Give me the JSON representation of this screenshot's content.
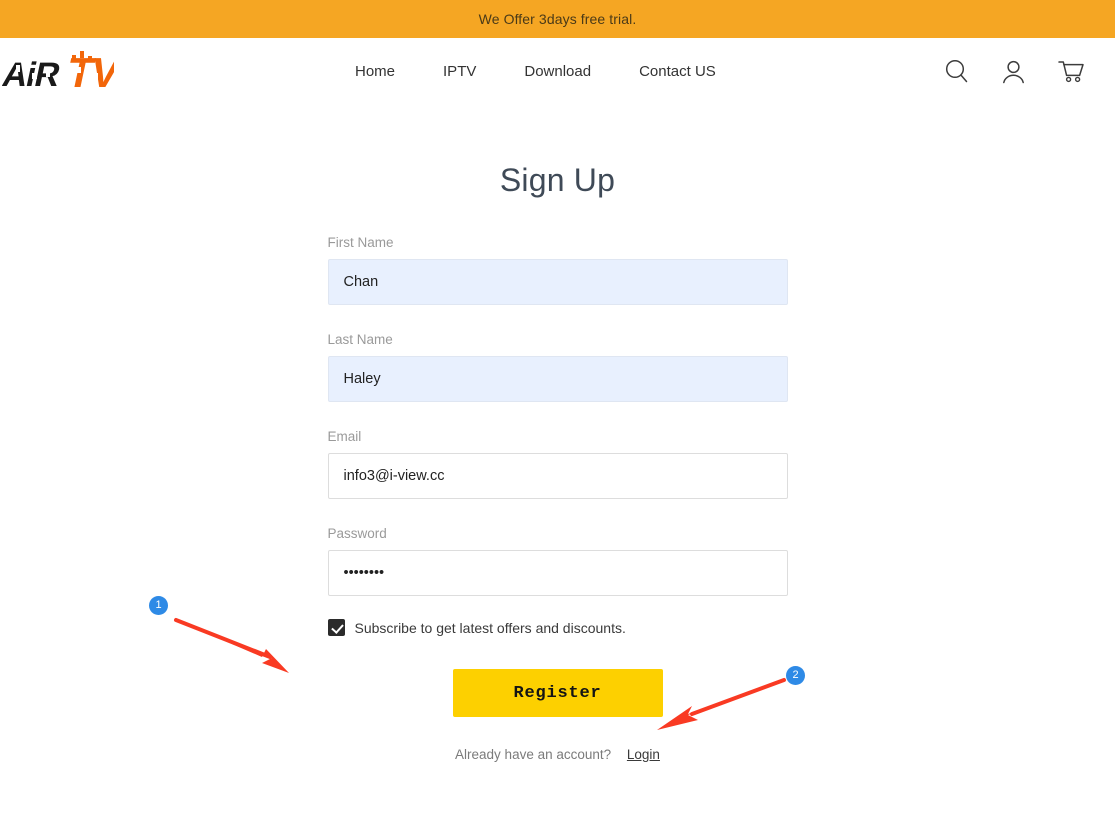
{
  "promo": {
    "text": "We Offer 3days free trial."
  },
  "header": {
    "logo": {
      "name": "airtv-logo",
      "text_dark": "AiR",
      "text_accent": "TV",
      "color_dark": "#1a1a1a",
      "color_accent": "#f2660a"
    },
    "nav": [
      {
        "label": "Home",
        "name": "nav-home"
      },
      {
        "label": "IPTV",
        "name": "nav-iptv"
      },
      {
        "label": "Download",
        "name": "nav-download"
      },
      {
        "label": "Contact US",
        "name": "nav-contact-us"
      }
    ],
    "icons": [
      {
        "name": "search-icon",
        "label": "Search"
      },
      {
        "name": "user-icon",
        "label": "Account"
      },
      {
        "name": "cart-icon",
        "label": "Cart"
      }
    ]
  },
  "main": {
    "title": "Sign Up",
    "fields": [
      {
        "label": "First Name",
        "value": "Chan",
        "placeholder": "First Name",
        "type": "text",
        "autofilled": true,
        "name": "first-name"
      },
      {
        "label": "Last Name",
        "value": "Haley",
        "placeholder": "Last Name",
        "type": "text",
        "autofilled": true,
        "name": "last-name"
      },
      {
        "label": "Email",
        "value": "info3@i-view.cc",
        "placeholder": "Email",
        "type": "text",
        "autofilled": false,
        "name": "email"
      },
      {
        "label": "Password",
        "value": "••••••••",
        "placeholder": "Password",
        "type": "password",
        "autofilled": false,
        "name": "password"
      }
    ],
    "subscribe": {
      "label": "Subscribe to get latest offers and discounts.",
      "checked": true
    },
    "register_label": "Register",
    "login_prompt": "Already have an account?",
    "login_link": "Login"
  },
  "annotations": {
    "accent_color": "#f93a23",
    "badge_color": "#2e8ae6",
    "markers": [
      {
        "id": "1",
        "label": "1",
        "target": "subscribe-checkbox"
      },
      {
        "id": "2",
        "label": "2",
        "target": "register-button"
      }
    ]
  },
  "colors": {
    "banner": "#f5a623",
    "button_yellow": "#fdd000",
    "autofill_blue": "#e8f0fe"
  }
}
